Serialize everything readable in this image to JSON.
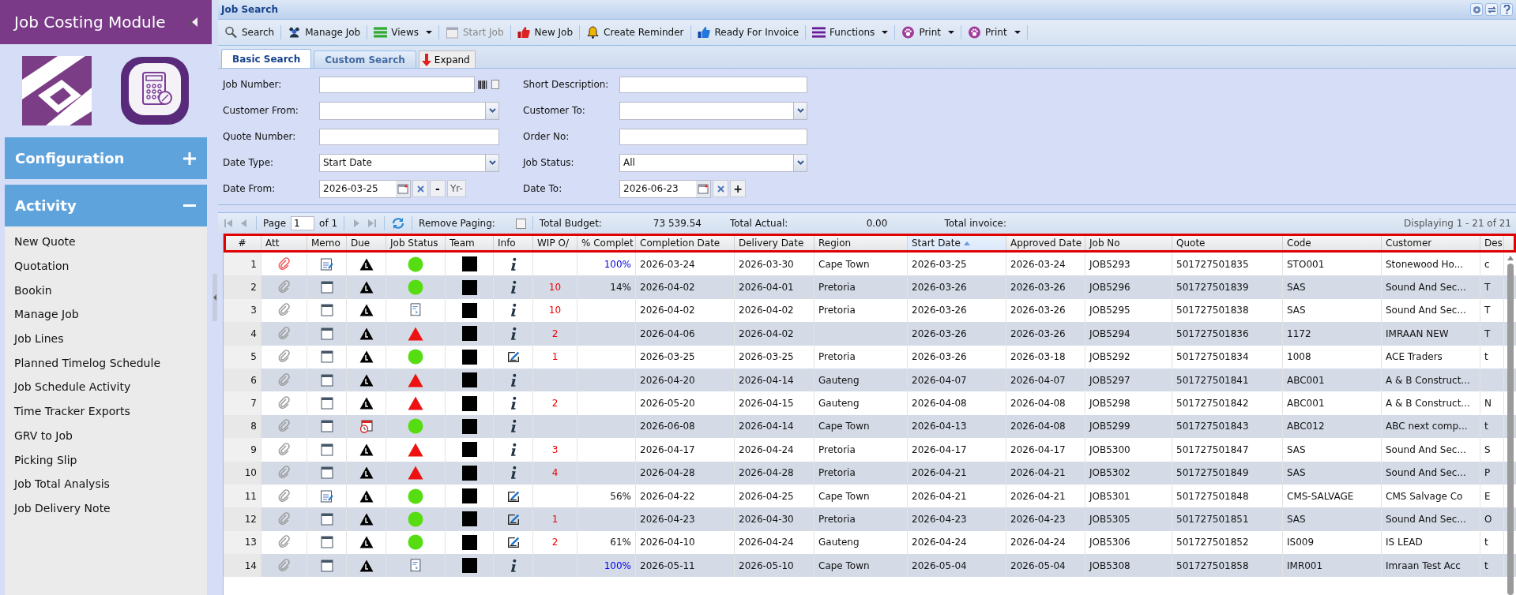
{
  "sidebar": {
    "title": "Job Costing Module",
    "sections": [
      {
        "label": "Configuration",
        "expanded": false
      },
      {
        "label": "Activity",
        "expanded": true,
        "items": [
          "New Quote",
          "Quotation",
          "Bookin",
          "Manage Job",
          "Job Lines",
          "Planned Timelog Schedule",
          "Job Schedule Activity",
          "Time Tracker Exports",
          "GRV to Job",
          "Picking Slip",
          "Job Total Analysis",
          "Job Delivery Note"
        ]
      }
    ]
  },
  "panel": {
    "title": "Job Search"
  },
  "toolbar": [
    {
      "label": "Search",
      "kind": "search",
      "disabled": false,
      "dropdown": false
    },
    {
      "label": "Manage Job",
      "kind": "people",
      "disabled": false,
      "dropdown": false
    },
    {
      "label": "Views",
      "kind": "bars",
      "disabled": false,
      "dropdown": true
    },
    {
      "label": "Start Job",
      "kind": "calendar",
      "disabled": true,
      "dropdown": false
    },
    {
      "label": "New Job",
      "kind": "thumbred",
      "disabled": false,
      "dropdown": false
    },
    {
      "label": "Create Reminder",
      "kind": "bell",
      "disabled": false,
      "dropdown": false
    },
    {
      "label": "Ready For Invoice",
      "kind": "thumbblue",
      "disabled": false,
      "dropdown": false
    },
    {
      "label": "Functions",
      "kind": "lines",
      "disabled": false,
      "dropdown": true
    },
    {
      "label": "Print",
      "kind": "paw",
      "disabled": false,
      "dropdown": true
    },
    {
      "label": "Print",
      "kind": "paw",
      "disabled": false,
      "dropdown": true
    }
  ],
  "tabs": [
    {
      "label": "Basic Search",
      "selected": true
    },
    {
      "label": "Custom Search",
      "selected": false
    }
  ],
  "expand_button": "Expand",
  "form": {
    "left": [
      {
        "label": "Job Number:",
        "kind": "text",
        "barcode_checked": false
      },
      {
        "label": "Customer From:",
        "kind": "combo"
      },
      {
        "label": "Quote Number:",
        "kind": "text"
      },
      {
        "label": "Date Type:",
        "kind": "combo",
        "value": "Start Date"
      },
      {
        "label": "Date From:",
        "kind": "date",
        "value": "2026-03-25",
        "step": "-",
        "extra": "Yr-"
      }
    ],
    "right": [
      {
        "label": "Short Description:",
        "kind": "text"
      },
      {
        "label": "Customer To:",
        "kind": "combo"
      },
      {
        "label": "Order No:",
        "kind": "text"
      },
      {
        "label": "Job Status:",
        "kind": "combo",
        "value": "All"
      },
      {
        "label": "Date To:",
        "kind": "date",
        "value": "2026-06-23",
        "step": "+"
      }
    ]
  },
  "paging": {
    "page_label": "Page",
    "page": "1",
    "of": "of 1",
    "remove_paging_label": "Remove Paging:",
    "remove_paging": false,
    "total_budget_label": "Total Budget:",
    "total_budget": "73 539.54",
    "total_actual_label": "Total Actual:",
    "total_actual": "0.00",
    "total_invoice_label": "Total invoice:",
    "displaying": "Displaying 1 - 21 of 21"
  },
  "table": {
    "columns": [
      {
        "label": "#",
        "sorted": false
      },
      {
        "label": "Att",
        "sorted": false
      },
      {
        "label": "Memo",
        "sorted": false
      },
      {
        "label": "Due",
        "sorted": false
      },
      {
        "label": "Job Status",
        "sorted": false
      },
      {
        "label": "Team",
        "sorted": false
      },
      {
        "label": "Info",
        "sorted": false
      },
      {
        "label": "WIP O/",
        "sorted": false
      },
      {
        "label": "% Complet",
        "sorted": false
      },
      {
        "label": "Completion Date",
        "sorted": false
      },
      {
        "label": "Delivery Date",
        "sorted": false
      },
      {
        "label": "Region",
        "sorted": false
      },
      {
        "label": "Start Date",
        "sorted": true
      },
      {
        "label": "Approved Date",
        "sorted": false
      },
      {
        "label": "Job No",
        "sorted": false
      },
      {
        "label": "Quote",
        "sorted": false
      },
      {
        "label": "Code",
        "sorted": false
      },
      {
        "label": "Customer",
        "sorted": false
      },
      {
        "label": "Des",
        "sorted": false
      }
    ],
    "rows": [
      {
        "number": "1",
        "att": {
          "kind": "flagged"
        },
        "memo": {
          "kind": "note"
        },
        "due": {
          "kind": "alert"
        },
        "status": {
          "kind": "green"
        },
        "info": {
          "kind": "info"
        },
        "percent": "100%",
        "percent_complete": true,
        "completion": "2026-03-24",
        "delivery": "2026-03-30",
        "region": "Cape Town",
        "start": "2026-03-25",
        "approved": "2026-03-24",
        "job_no": "JOB5293",
        "quote": "501727501835",
        "code": "STO001",
        "customer": "Stonewood Ho...",
        "column_19": "c"
      },
      {
        "number": "2",
        "att": {
          "kind": "plain"
        },
        "memo": {
          "kind": "blank"
        },
        "due": {
          "kind": "alert"
        },
        "status": {
          "kind": "green"
        },
        "info": {
          "kind": "info"
        },
        "wip": "10",
        "percent": "14%",
        "percent_complete": false,
        "completion": "2026-04-02",
        "delivery": "2026-04-01",
        "region": "Pretoria",
        "start": "2026-03-26",
        "approved": "2026-03-26",
        "job_no": "JOB5296",
        "quote": "501727501839",
        "code": "SAS",
        "customer": "Sound And Sec...",
        "column_19": "T"
      },
      {
        "number": "3",
        "att": {
          "kind": "plain"
        },
        "memo": {
          "kind": "blank"
        },
        "due": {
          "kind": "alert"
        },
        "status": {
          "kind": "document"
        },
        "info": {
          "kind": "info"
        },
        "wip": "10",
        "completion": "2026-04-02",
        "delivery": "2026-04-02",
        "region": "Pretoria",
        "start": "2026-03-26",
        "approved": "2026-03-26",
        "job_no": "JOB5295",
        "quote": "501727501838",
        "code": "SAS",
        "customer": "Sound And Sec...",
        "column_19": "T"
      },
      {
        "number": "4",
        "att": {
          "kind": "plain"
        },
        "memo": {
          "kind": "blank"
        },
        "due": {
          "kind": "alert"
        },
        "status": {
          "kind": "red"
        },
        "info": {
          "kind": "info"
        },
        "wip": "2",
        "completion": "2026-04-06",
        "delivery": "2026-04-02",
        "start": "2026-03-26",
        "approved": "2026-03-26",
        "job_no": "JOB5294",
        "quote": "501727501836",
        "code": "1172",
        "customer": "IMRAAN NEW",
        "column_19": "T"
      },
      {
        "number": "5",
        "att": {
          "kind": "plain"
        },
        "memo": {
          "kind": "blank"
        },
        "due": {
          "kind": "alert"
        },
        "status": {
          "kind": "green"
        },
        "info": {
          "kind": "edit"
        },
        "wip": "1",
        "completion": "2026-03-25",
        "delivery": "2026-03-25",
        "region": "Pretoria",
        "start": "2026-03-26",
        "approved": "2026-03-18",
        "job_no": "JOB5292",
        "quote": "501727501834",
        "code": "1008",
        "customer": "ACE Traders",
        "column_19": "t"
      },
      {
        "number": "6",
        "att": {
          "kind": "plain"
        },
        "memo": {
          "kind": "blank"
        },
        "due": {
          "kind": "alert"
        },
        "status": {
          "kind": "red"
        },
        "info": {
          "kind": "info"
        },
        "completion": "2026-04-20",
        "delivery": "2026-04-14",
        "region": "Gauteng",
        "start": "2026-04-07",
        "approved": "2026-04-07",
        "job_no": "JOB5297",
        "quote": "501727501841",
        "code": "ABC001",
        "customer": "A & B Construct..."
      },
      {
        "number": "7",
        "att": {
          "kind": "plain"
        },
        "memo": {
          "kind": "blank"
        },
        "due": {
          "kind": "alert"
        },
        "status": {
          "kind": "red"
        },
        "info": {
          "kind": "info"
        },
        "wip": "2",
        "completion": "2026-05-20",
        "delivery": "2026-04-15",
        "region": "Gauteng",
        "start": "2026-04-08",
        "approved": "2026-04-08",
        "job_no": "JOB5298",
        "quote": "501727501842",
        "code": "ABC001",
        "customer": "A & B Construct...",
        "column_19": "N"
      },
      {
        "number": "8",
        "att": {
          "kind": "plain"
        },
        "memo": {
          "kind": "blank"
        },
        "due": {
          "kind": "clock"
        },
        "status": {
          "kind": "green"
        },
        "info": {
          "kind": "info"
        },
        "completion": "2026-06-08",
        "delivery": "2026-04-14",
        "region": "Cape Town",
        "start": "2026-04-13",
        "approved": "2026-04-08",
        "job_no": "JOB5299",
        "quote": "501727501843",
        "code": "ABC012",
        "customer": "ABC next comp...",
        "column_19": "t"
      },
      {
        "number": "9",
        "att": {
          "kind": "plain"
        },
        "memo": {
          "kind": "blank"
        },
        "due": {
          "kind": "alert"
        },
        "status": {
          "kind": "red"
        },
        "info": {
          "kind": "info"
        },
        "wip": "3",
        "completion": "2026-04-17",
        "delivery": "2026-04-24",
        "region": "Pretoria",
        "start": "2026-04-17",
        "approved": "2026-04-17",
        "job_no": "JOB5300",
        "quote": "501727501847",
        "code": "SAS",
        "customer": "Sound And Sec...",
        "column_19": "S"
      },
      {
        "number": "10",
        "att": {
          "kind": "plain"
        },
        "memo": {
          "kind": "blank"
        },
        "due": {
          "kind": "alert"
        },
        "status": {
          "kind": "red"
        },
        "info": {
          "kind": "info"
        },
        "wip": "4",
        "completion": "2026-04-28",
        "delivery": "2026-04-28",
        "region": "Pretoria",
        "start": "2026-04-21",
        "approved": "2026-04-21",
        "job_no": "JOB5302",
        "quote": "501727501849",
        "code": "SAS",
        "customer": "Sound And Sec...",
        "column_19": "P"
      },
      {
        "number": "11",
        "att": {
          "kind": "plain"
        },
        "memo": {
          "kind": "note"
        },
        "due": {
          "kind": "alert"
        },
        "status": {
          "kind": "green"
        },
        "info": {
          "kind": "edit"
        },
        "percent": "56%",
        "percent_complete": false,
        "completion": "2026-04-22",
        "delivery": "2026-04-25",
        "region": "Cape Town",
        "start": "2026-04-21",
        "approved": "2026-04-21",
        "job_no": "JOB5301",
        "quote": "501727501848",
        "code": "CMS-SALVAGE",
        "customer": "CMS Salvage Co",
        "column_19": "E"
      },
      {
        "number": "12",
        "att": {
          "kind": "plain"
        },
        "memo": {
          "kind": "blank"
        },
        "due": {
          "kind": "alert"
        },
        "status": {
          "kind": "green"
        },
        "info": {
          "kind": "edit"
        },
        "wip": "1",
        "completion": "2026-04-23",
        "delivery": "2026-04-30",
        "region": "Pretoria",
        "start": "2026-04-23",
        "approved": "2026-04-23",
        "job_no": "JOB5305",
        "quote": "501727501851",
        "code": "SAS",
        "customer": "Sound And Sec...",
        "column_19": "O"
      },
      {
        "number": "13",
        "att": {
          "kind": "plain"
        },
        "memo": {
          "kind": "blank"
        },
        "due": {
          "kind": "alert"
        },
        "status": {
          "kind": "green"
        },
        "info": {
          "kind": "edit"
        },
        "wip": "2",
        "percent": "61%",
        "percent_complete": false,
        "completion": "2026-04-10",
        "delivery": "2026-04-24",
        "region": "Gauteng",
        "start": "2026-04-24",
        "approved": "2026-04-24",
        "job_no": "JOB5306",
        "quote": "501727501852",
        "code": "IS009",
        "customer": "IS LEAD",
        "column_19": "t"
      },
      {
        "number": "14",
        "att": {
          "kind": "plain"
        },
        "memo": {
          "kind": "blank"
        },
        "due": {
          "kind": "alert"
        },
        "status": {
          "kind": "document"
        },
        "info": {
          "kind": "info"
        },
        "percent": "100%",
        "percent_complete": true,
        "completion": "2026-05-11",
        "delivery": "2026-05-10",
        "region": "Cape Town",
        "start": "2026-05-04",
        "approved": "2026-05-04",
        "job_no": "JOB5308",
        "quote": "501727501858",
        "code": "IMR001",
        "customer": "Imraan Test Acc",
        "column_19": "t"
      }
    ]
  }
}
